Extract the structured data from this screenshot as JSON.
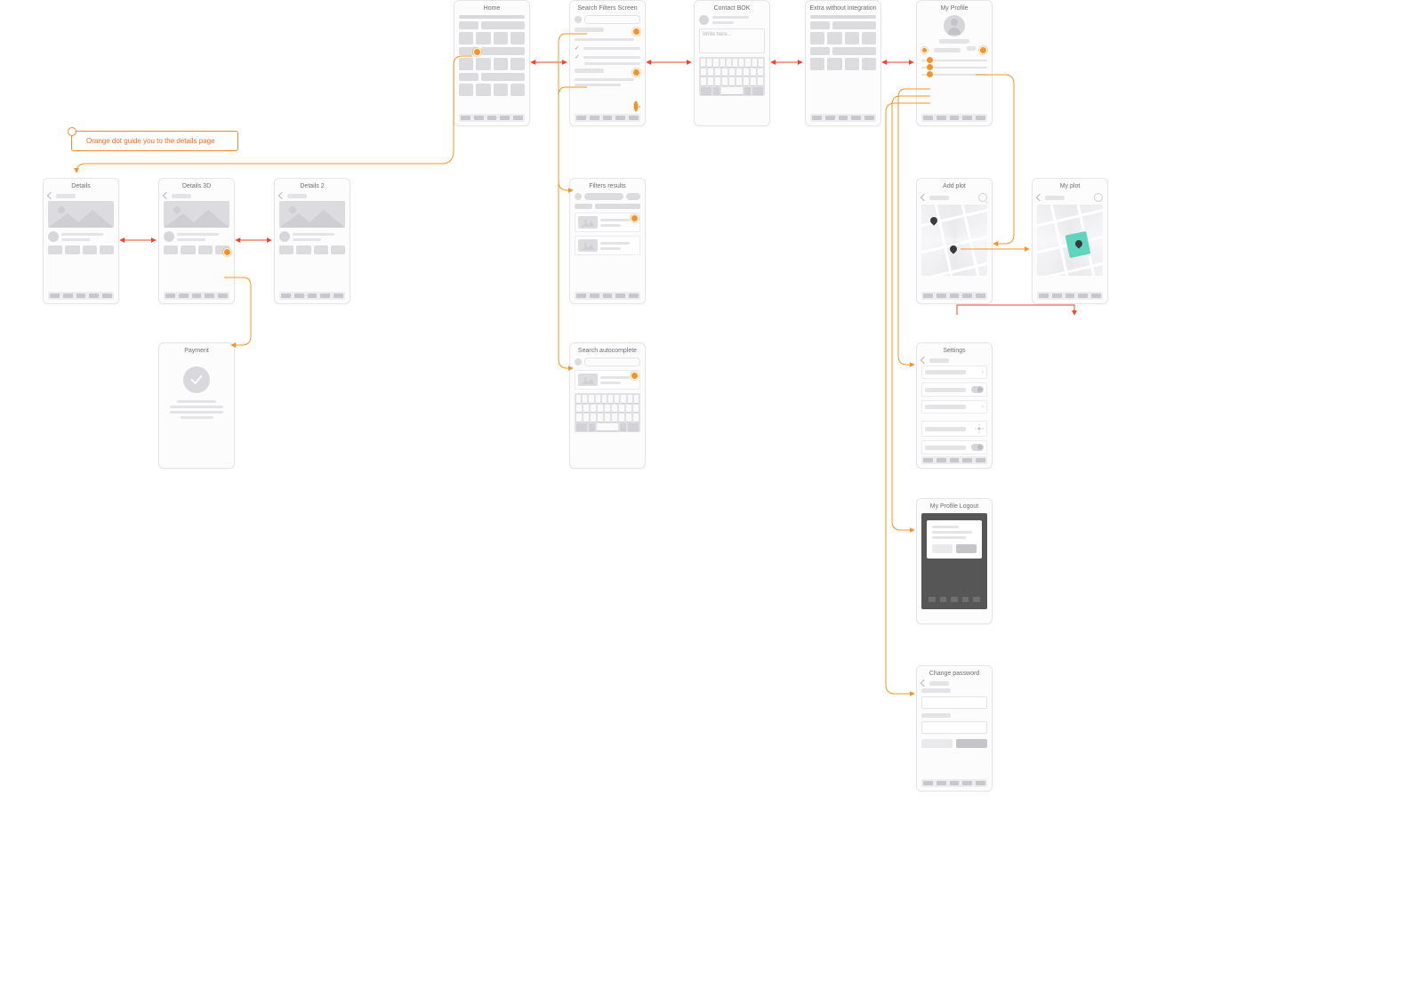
{
  "callout": {
    "text": "Orange dot guide you to the details page"
  },
  "contact": {
    "placeholder": "Write here..."
  },
  "screens": {
    "home": "Home",
    "searchFilters": "Search Filters Screen",
    "contactBOK": "Contact BOK",
    "extra": "Extra without integration",
    "myProfile": "My Profile",
    "details": "Details",
    "details3d": "Details 3D",
    "details2": "Details 2",
    "payment": "Payment",
    "filtersResults": "Filters results",
    "searchAutocomplete": "Search autocomplete",
    "addPlot": "Add plot",
    "myPlot": "My plot",
    "settings": "Settings",
    "myProfileLogout": "My Profile Logout",
    "changePassword": "Change password"
  }
}
